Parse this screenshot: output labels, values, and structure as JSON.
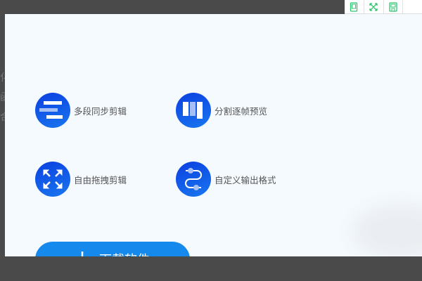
{
  "toolbar": {
    "icons": [
      "phone-icon",
      "fullscreen-icon",
      "save-icon"
    ]
  },
  "left_strip": {
    "chars": [
      "化",
      "函",
      "合"
    ]
  },
  "features": [
    {
      "label": "多段同步剪辑",
      "icon": "multi-segment-icon"
    },
    {
      "label": "分割逐帧预览",
      "icon": "frame-split-icon"
    },
    {
      "label": "自由拖拽剪辑",
      "icon": "drag-arrows-icon"
    },
    {
      "label": "自定义输出格式",
      "icon": "output-format-icon"
    }
  ],
  "download_button": {
    "label": "下载软件",
    "icon": "download-icon"
  },
  "colors": {
    "accent": "#1589ec",
    "icon_green": "#2fc36f",
    "panel_bg": "#f5faff"
  }
}
